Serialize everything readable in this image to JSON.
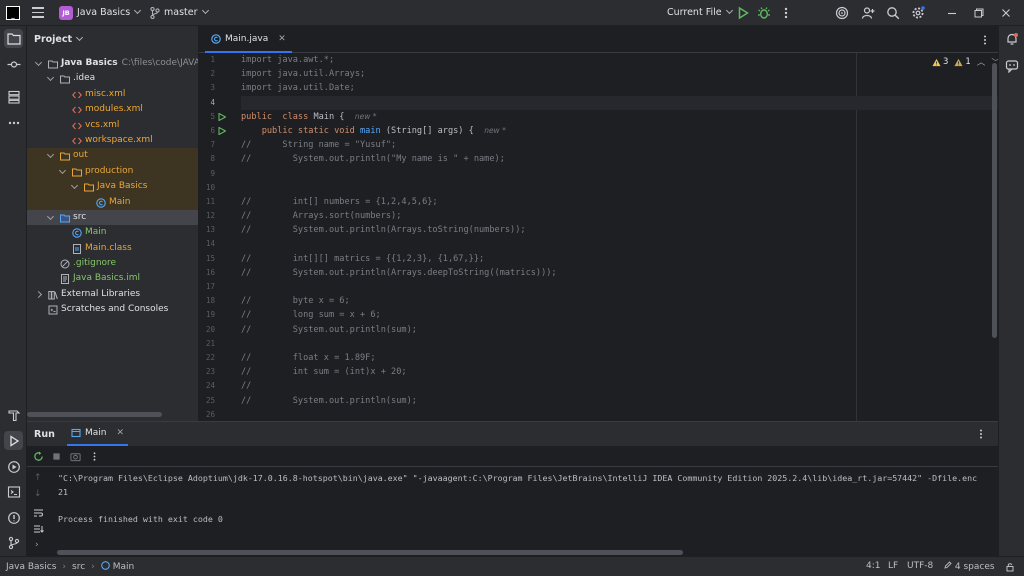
{
  "titlebar": {
    "project_badge": "JB",
    "project_name": "Java Basics",
    "branch": "master",
    "run_config": "Current File"
  },
  "project_panel": {
    "title": "Project",
    "tree": [
      {
        "label": "Java Basics",
        "hint": "C:\\files\\code\\JAVA\\Ja",
        "indent": 0,
        "arrow": "down",
        "icon": "folder-icon",
        "style": "bold",
        "bg": ""
      },
      {
        "label": ".idea",
        "indent": 1,
        "arrow": "down",
        "icon": "folder-icon",
        "style": "plain",
        "bg": ""
      },
      {
        "label": "misc.xml",
        "indent": 2,
        "arrow": "",
        "icon": "xml-icon",
        "style": "xml",
        "bg": ""
      },
      {
        "label": "modules.xml",
        "indent": 2,
        "arrow": "",
        "icon": "xml-icon",
        "style": "xml",
        "bg": ""
      },
      {
        "label": "vcs.xml",
        "indent": 2,
        "arrow": "",
        "icon": "xml-icon",
        "style": "xml",
        "bg": ""
      },
      {
        "label": "workspace.xml",
        "indent": 2,
        "arrow": "",
        "icon": "xml-icon",
        "style": "xml",
        "bg": ""
      },
      {
        "label": "out",
        "indent": 1,
        "arrow": "down",
        "icon": "folder-orange-icon",
        "style": "orange",
        "bg": "out"
      },
      {
        "label": "production",
        "indent": 2,
        "arrow": "down",
        "icon": "folder-orange-icon",
        "style": "orange",
        "bg": "out"
      },
      {
        "label": "Java Basics",
        "indent": 3,
        "arrow": "down",
        "icon": "folder-orange-icon",
        "style": "orange",
        "bg": "out"
      },
      {
        "label": "Main",
        "indent": 4,
        "arrow": "",
        "icon": "class-icon",
        "style": "orange",
        "bg": "out"
      },
      {
        "label": "src",
        "indent": 1,
        "arrow": "down",
        "icon": "source-folder-icon",
        "style": "plain",
        "bg": "selected"
      },
      {
        "label": "Main",
        "indent": 2,
        "arrow": "",
        "icon": "class-icon",
        "style": "green",
        "bg": ""
      },
      {
        "label": "Main.class",
        "indent": 2,
        "arrow": "",
        "icon": "class-file-icon",
        "style": "orange",
        "bg": ""
      },
      {
        "label": ".gitignore",
        "indent": 1,
        "arrow": "",
        "icon": "gitignore-icon",
        "style": "green",
        "bg": ""
      },
      {
        "label": "Java Basics.iml",
        "indent": 1,
        "arrow": "",
        "icon": "iml-icon",
        "style": "green",
        "bg": ""
      },
      {
        "label": "External Libraries",
        "indent": 0,
        "arrow": "right",
        "icon": "library-icon",
        "style": "plain",
        "bg": ""
      },
      {
        "label": "Scratches and Consoles",
        "indent": 0,
        "arrow": "",
        "icon": "scratches-icon",
        "style": "plain",
        "bg": ""
      }
    ]
  },
  "editor": {
    "tab_label": "Main.java",
    "warnings": "3",
    "weak_warnings": "1",
    "current_line": 4,
    "lines": [
      [
        [
          "import java.awt.*;",
          "comment"
        ]
      ],
      [
        [
          "import java.util.Arrays;",
          "comment"
        ]
      ],
      [
        [
          "import java.util.Date;",
          "comment"
        ]
      ],
      [],
      [
        [
          "public  class ",
          "kw"
        ],
        [
          "Main {  ",
          ""
        ],
        [
          "new *",
          "hint"
        ]
      ],
      [
        [
          "    public static void ",
          "kw"
        ],
        [
          "main ",
          "fn"
        ],
        [
          "(String[] args) {  ",
          ""
        ],
        [
          "new *",
          "hint"
        ]
      ],
      [
        [
          "//      String name = \"Yusuf\";",
          "comment"
        ]
      ],
      [
        [
          "//        System.out.println(\"My name is \" + name);",
          "comment"
        ]
      ],
      [],
      [],
      [
        [
          "//        int[] numbers = {1,2,4,5,6};",
          "comment"
        ]
      ],
      [
        [
          "//        Arrays.sort(numbers);",
          "comment"
        ]
      ],
      [
        [
          "//        System.out.println(Arrays.toString(numbers));",
          "comment"
        ]
      ],
      [],
      [
        [
          "//        int[][] matrics = {{1,2,3}, {1,67,}};",
          "comment"
        ]
      ],
      [
        [
          "//        System.out.println(Arrays.deepToString((matrics)));",
          "comment"
        ]
      ],
      [],
      [
        [
          "//        byte x = 6;",
          "comment"
        ]
      ],
      [
        [
          "//        long sum = x + 6;",
          "comment"
        ]
      ],
      [
        [
          "//        System.out.println(sum);",
          "comment"
        ]
      ],
      [],
      [
        [
          "//        float x = 1.89F;",
          "comment"
        ]
      ],
      [
        [
          "//        int sum = (int)x + 20;",
          "comment"
        ]
      ],
      [
        [
          "//",
          "comment"
        ]
      ],
      [
        [
          "//        System.out.println(sum);",
          "comment"
        ]
      ],
      []
    ],
    "run_markers": [
      5,
      6
    ]
  },
  "run_panel": {
    "title": "Run",
    "tab_label": "Main",
    "console": [
      "\"C:\\Program Files\\Eclipse Adoptium\\jdk-17.0.16.8-hotspot\\bin\\java.exe\" \"-javaagent:C:\\Program Files\\JetBrains\\IntelliJ IDEA Community Edition 2025.2.4\\lib\\idea_rt.jar=57442\" -Dfile.enc",
      "21",
      "",
      "Process finished with exit code 0"
    ]
  },
  "statusbar": {
    "breadcrumb": [
      "Java Basics",
      "src",
      "Main"
    ],
    "position": "4:1",
    "line_sep": "LF",
    "encoding": "UTF-8",
    "indent": "4 spaces"
  },
  "colors": {
    "accent": "#3574f0",
    "run_green": "#5fb85f",
    "badge": "#b45bd6",
    "warning": "#f2c55c"
  }
}
